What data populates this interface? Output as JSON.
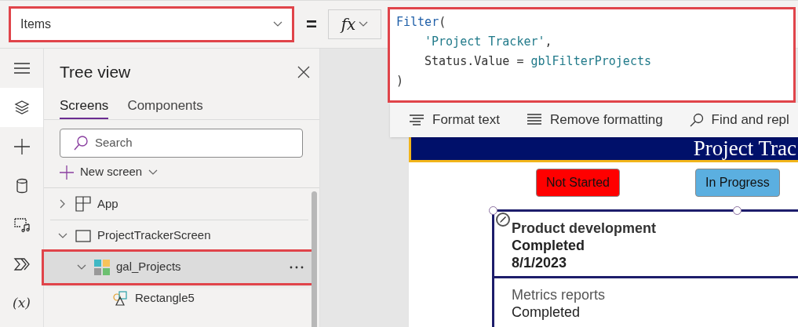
{
  "property_selector": {
    "value": "Items"
  },
  "equals": "=",
  "fx_button": {
    "label": "fx"
  },
  "formula": {
    "lines": [
      {
        "indented": false,
        "tokens": [
          {
            "kind": "function",
            "text": "Filter"
          },
          {
            "kind": "plain",
            "text": "("
          }
        ]
      },
      {
        "indented": true,
        "tokens": [
          {
            "kind": "string",
            "text": "'Project Tracker'"
          },
          {
            "kind": "plain",
            "text": ","
          }
        ]
      },
      {
        "indented": true,
        "tokens": [
          {
            "kind": "plain",
            "text": "Status.Value = "
          },
          {
            "kind": "variable",
            "text": "gblFilterProjects"
          }
        ]
      },
      {
        "indented": false,
        "tokens": [
          {
            "kind": "plain",
            "text": ")"
          }
        ]
      }
    ]
  },
  "formula_toolbar": [
    {
      "kind": "format",
      "label": "Format text"
    },
    {
      "kind": "remove",
      "label": "Remove formatting"
    },
    {
      "kind": "find",
      "label": "Find and repl"
    }
  ],
  "rail": [
    {
      "kind": "menu",
      "selected": false
    },
    {
      "kind": "layers",
      "selected": true
    },
    {
      "kind": "insert",
      "selected": false
    },
    {
      "kind": "data",
      "selected": false
    },
    {
      "kind": "media",
      "selected": false
    },
    {
      "kind": "flows",
      "selected": false
    },
    {
      "kind": "variables",
      "label": "(x)",
      "selected": false
    }
  ],
  "tree_view": {
    "title": "Tree view",
    "tabs": [
      {
        "label": "Screens",
        "selected": true
      },
      {
        "label": "Components",
        "selected": false
      }
    ],
    "search": {
      "placeholder": "Search"
    },
    "new_screen": "New screen",
    "items": [
      {
        "kind": "app",
        "label": "App",
        "expanded": false,
        "selected": false
      },
      {
        "kind": "screen",
        "label": "ProjectTrackerScreen",
        "expanded": true,
        "selected": false,
        "children": [
          {
            "kind": "gallery",
            "label": "gal_Projects",
            "expanded": true,
            "selected": true,
            "children": [
              {
                "kind": "shape",
                "label": "Rectangle5",
                "expanded": false,
                "selected": false
              }
            ]
          }
        ]
      }
    ]
  },
  "app_screen": {
    "header": "Project Trac",
    "buttons": [
      {
        "label": "Not Started",
        "color": "#ff0000"
      },
      {
        "label": "In Progress",
        "color": "#5bafe0"
      }
    ],
    "gallery": [
      {
        "title": "Product development",
        "status": "Completed",
        "date": "8/1/2023",
        "selected": true
      },
      {
        "title": "Metrics reports",
        "status": "Completed",
        "selected": false
      }
    ]
  }
}
